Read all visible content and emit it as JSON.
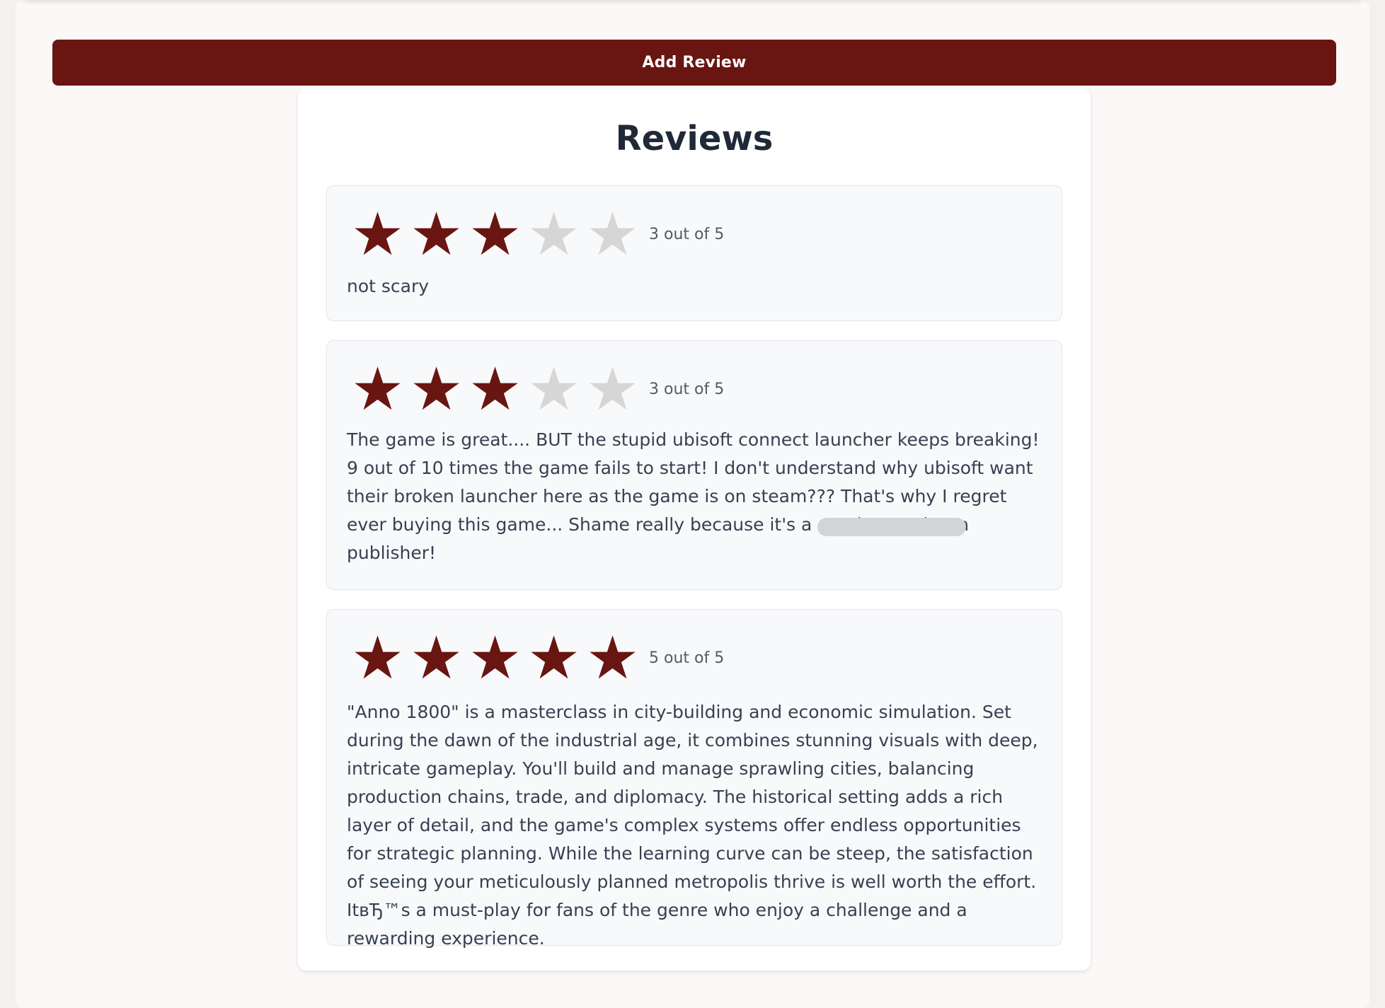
{
  "actions": {
    "add_review_label": "Add Review"
  },
  "reviews_section": {
    "title": "Reviews",
    "colors": {
      "accent": "#691511",
      "star_empty": "#d6d6d6"
    },
    "reviews": [
      {
        "rating": 3,
        "max_rating": 5,
        "rating_text": "3 out of 5",
        "text": "not scary"
      },
      {
        "rating": 3,
        "max_rating": 5,
        "rating_text": "3 out of 5",
        "text": "The game is great.... BUT the stupid ubisoft connect launcher keeps breaking! 9 out of 10 times the game fails to start! I don't understand why ubisoft want their broken launcher here as the game is on steam??? That's why I regret ever buying this game... Shame really because it's a good game but a publisher!"
      },
      {
        "rating": 5,
        "max_rating": 5,
        "rating_text": "5 out of 5",
        "text": "\"Anno 1800\" is a masterclass in city-building and economic simulation. Set during the dawn of the industrial age, it combines stunning visuals with deep, intricate gameplay. You'll build and manage sprawling cities, balancing production chains, trade, and diplomacy. The historical setting adds a rich layer of detail, and the game's complex systems offer endless opportunities for strategic planning. While the learning curve can be steep, the satisfaction of seeing your meticulously planned metropolis thrive is well worth the effort. ItвЂ™s a must-play for fans of the genre who enjoy a challenge and a rewarding experience."
      }
    ]
  }
}
